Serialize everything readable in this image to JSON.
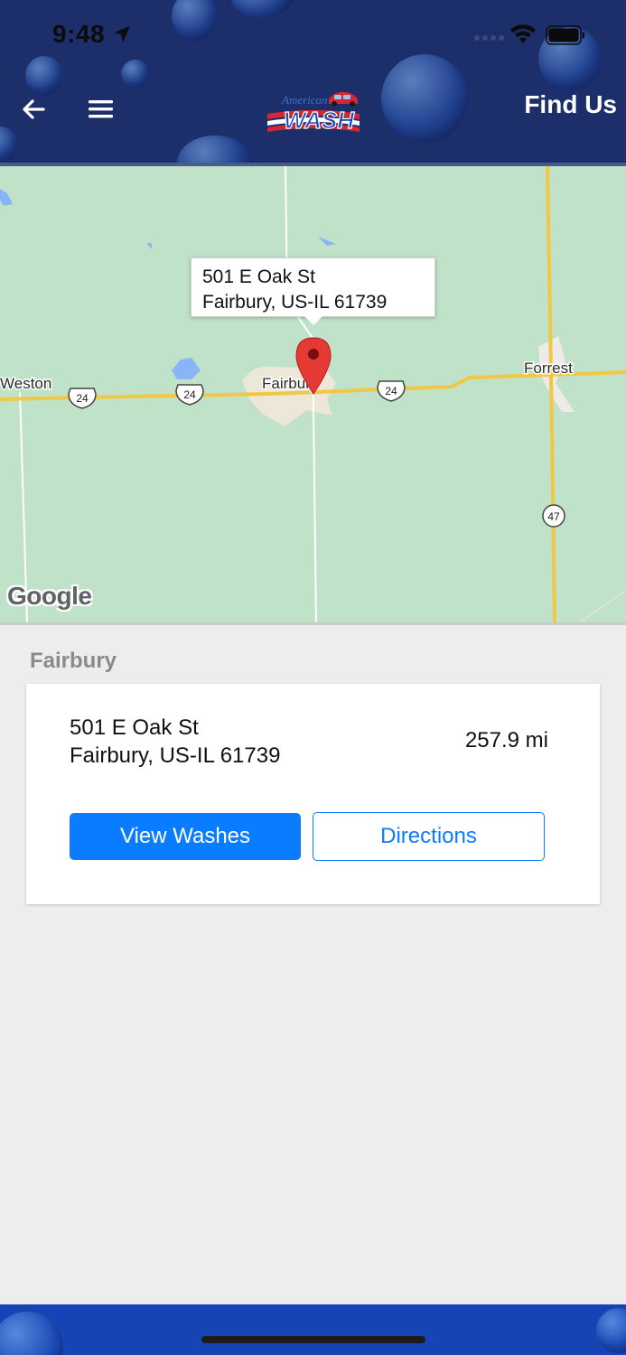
{
  "status_bar": {
    "time": "9:48",
    "icons": [
      "location-arrow-icon",
      "cell-signal-icon",
      "wifi-icon",
      "battery-icon"
    ]
  },
  "header": {
    "back_icon": "arrow-left-icon",
    "menu_icon": "hamburger-menu-icon",
    "logo_text_top": "American",
    "logo_text_main": "WASH",
    "title": "Find Us",
    "background_color": "#1d2f6b"
  },
  "map": {
    "popup": {
      "line1": "501 E Oak St",
      "line2": "Fairbury, US-IL  61739"
    },
    "places": {
      "weston": "Weston",
      "fairbury": "Fairbury",
      "forrest": "Forrest"
    },
    "route_shields": {
      "us24_a": "24",
      "us24_b": "24",
      "us24_c": "24",
      "il47": "47"
    },
    "attribution": "Google",
    "marker_color": "#e53935"
  },
  "locations": {
    "section_title": "Fairbury",
    "items": [
      {
        "address_line1": "501 E Oak St",
        "address_line2": "Fairbury, US-IL  61739",
        "distance": "257.9 mi",
        "primary_button": "View Washes",
        "secondary_button": "Directions"
      }
    ]
  },
  "colors": {
    "accent": "#0a7cff",
    "footer": "#1644b4"
  }
}
